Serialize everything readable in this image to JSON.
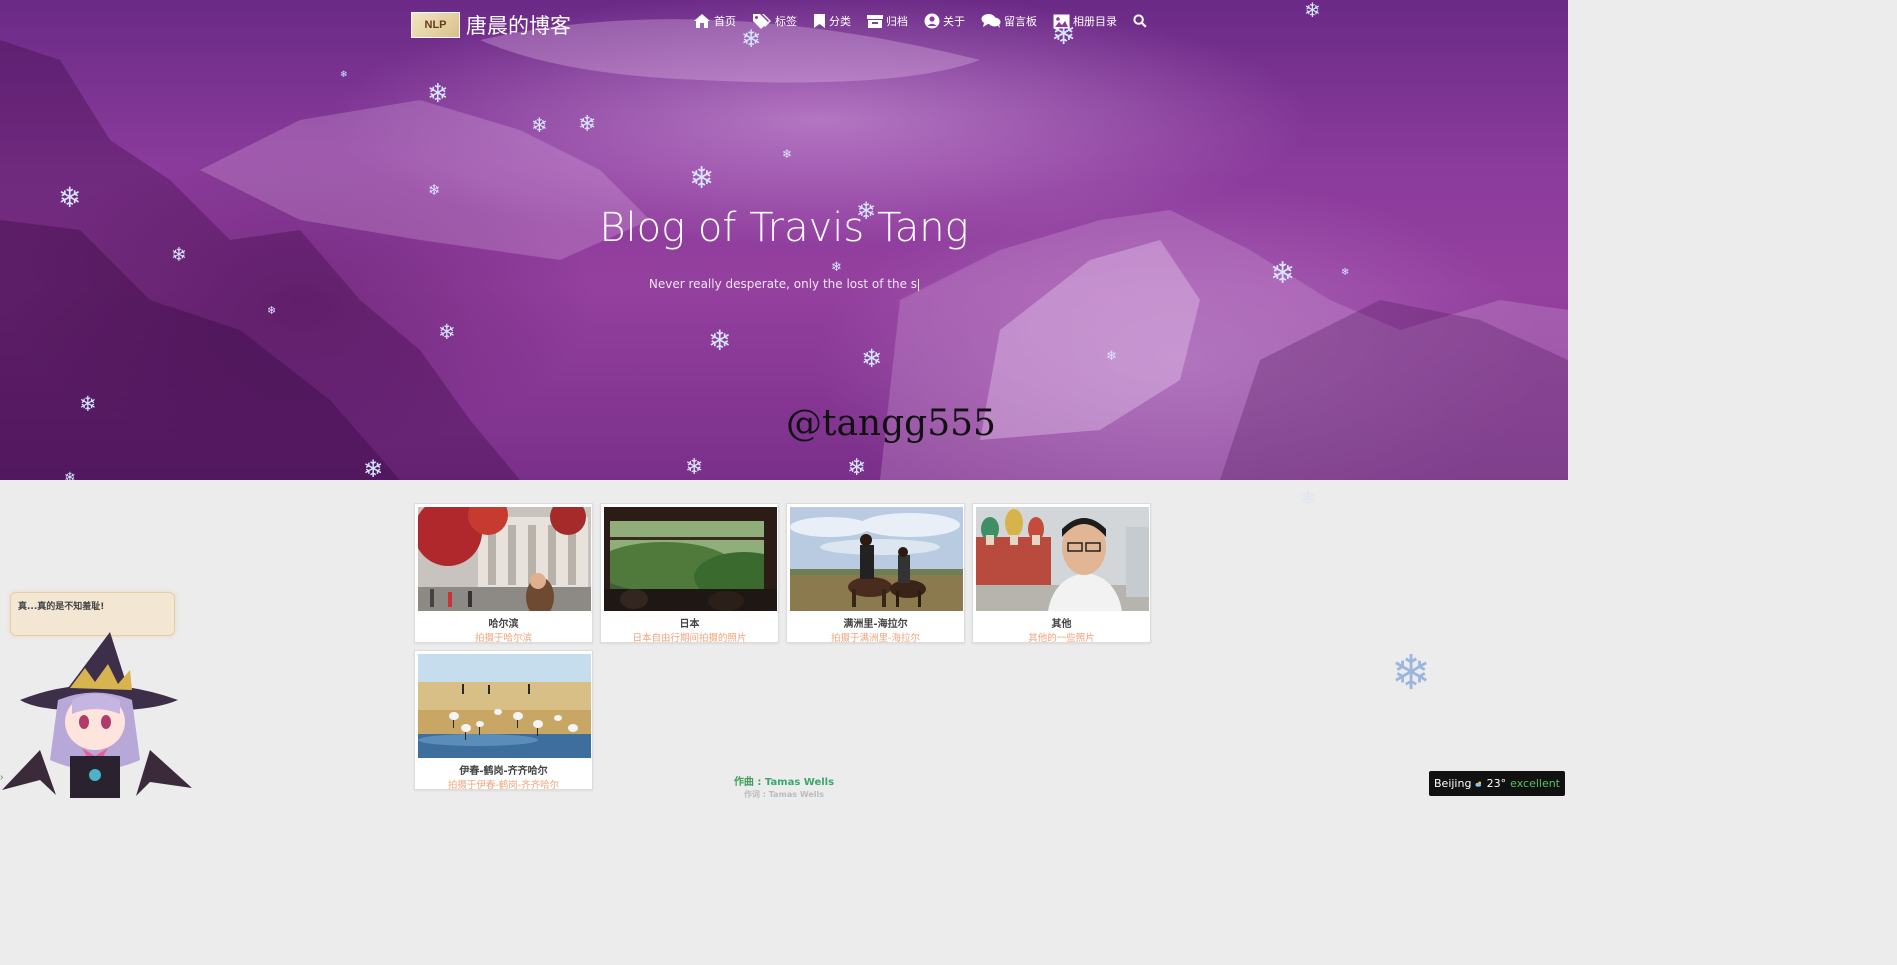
{
  "site": {
    "logo_text": "NLP",
    "title": "唐晨的博客"
  },
  "nav": {
    "items": [
      {
        "label": "首页",
        "icon": "home-icon"
      },
      {
        "label": "标签",
        "icon": "tags-icon"
      },
      {
        "label": "分类",
        "icon": "bookmark-icon"
      },
      {
        "label": "归档",
        "icon": "archive-icon"
      },
      {
        "label": "关于",
        "icon": "user-circle-icon"
      },
      {
        "label": "留言板",
        "icon": "comments-icon"
      },
      {
        "label": "相册目录",
        "icon": "image-icon"
      }
    ],
    "search_icon": "search-icon"
  },
  "hero": {
    "title": "Blog of Travis Tang",
    "subtitle": "Never really desperate, only the lost of the s",
    "handle": "@tangg555"
  },
  "albums": [
    {
      "title": "哈尔滨",
      "desc": "拍摄于哈尔滨"
    },
    {
      "title": "日本",
      "desc": "日本自由行期间拍摄的照片"
    },
    {
      "title": "满洲里-海拉尔",
      "desc": "拍摄于满洲里-海拉尔"
    },
    {
      "title": "其他",
      "desc": "其他的一些照片"
    },
    {
      "title": "伊春-鹤岗-齐齐哈尔",
      "desc": "拍摄于伊春-鹤岗-齐齐哈尔"
    }
  ],
  "mascot": {
    "speech": "真...真的是不知羞耻!"
  },
  "music": {
    "composer_label": "作曲 : ",
    "composer": "Tamas Wells",
    "lyricist_label": "作词 : ",
    "lyricist": "Tamas Wells"
  },
  "weather": {
    "city": "Beijing",
    "temp": "23°",
    "quality": "excellent",
    "icon": "cloud-sun-icon"
  },
  "colors": {
    "hero_purple": "#8b3b9c",
    "desc_orange": "#f0a37a",
    "music_green": "#3a9e58",
    "aq_green": "#56c25e"
  }
}
